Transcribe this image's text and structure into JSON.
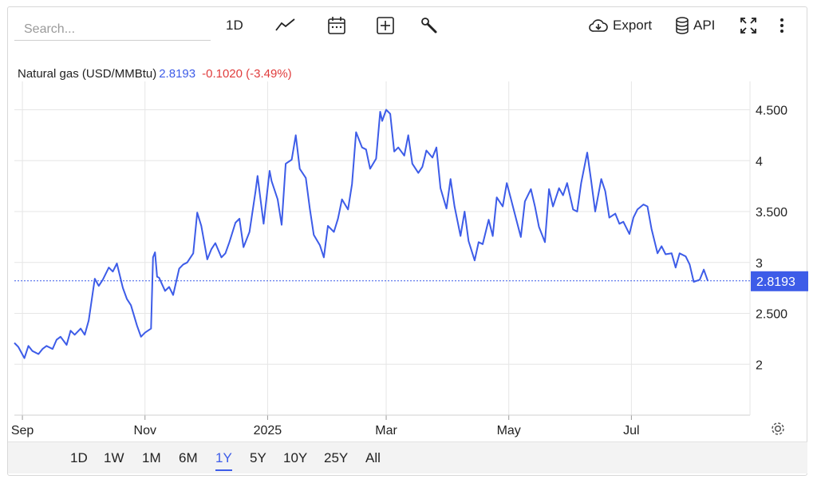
{
  "toolbar": {
    "search_placeholder": "Search...",
    "interval_label": "1D",
    "export_label": "Export",
    "api_label": "API",
    "icons": [
      "line-chart-icon",
      "calendar-icon",
      "add-indicator-icon",
      "wrench-icon",
      "cloud-download-icon",
      "database-icon",
      "fullscreen-icon",
      "more-vertical-icon"
    ]
  },
  "legend": {
    "name": "Natural gas (USD/MMBtu)",
    "price": "2.8193",
    "change": "-0.1020 (-3.49%)"
  },
  "colors": {
    "line": "#3d5ce8",
    "negative": "#e03c3c",
    "grid": "#e6e6e6"
  },
  "range_buttons": [
    "1D",
    "1W",
    "1M",
    "6M",
    "1Y",
    "5Y",
    "10Y",
    "25Y",
    "All"
  ],
  "active_range": "1Y",
  "chart_data": {
    "type": "line",
    "title": "Natural gas (USD/MMBtu)",
    "xlabel": "",
    "ylabel": "",
    "ylim": [
      1.5,
      4.7
    ],
    "y_ticks": [
      2,
      2.5,
      3,
      3.5,
      4,
      4.5
    ],
    "y_tick_labels": [
      "2",
      "2.500",
      "3",
      "3.500",
      "4",
      "4.500"
    ],
    "x_tick_labels": [
      "Sep",
      "Nov",
      "2025",
      "Mar",
      "May",
      "Jul"
    ],
    "x_tick_dates": [
      "2024-09-01",
      "2024-11-01",
      "2025-01-01",
      "2025-03-01",
      "2025-05-01",
      "2025-07-01"
    ],
    "x_range": [
      "2024-08-28",
      "2025-08-29"
    ],
    "last_value": 2.8193,
    "last_value_label": "2.8193",
    "grid": true,
    "series": [
      {
        "values": [
          [
            "2024-08-28",
            2.21
          ],
          [
            "2024-08-30",
            2.17
          ],
          [
            "2024-09-02",
            2.06
          ],
          [
            "2024-09-04",
            2.18
          ],
          [
            "2024-09-06",
            2.13
          ],
          [
            "2024-09-09",
            2.1
          ],
          [
            "2024-09-11",
            2.15
          ],
          [
            "2024-09-13",
            2.18
          ],
          [
            "2024-09-16",
            2.15
          ],
          [
            "2024-09-18",
            2.24
          ],
          [
            "2024-09-20",
            2.27
          ],
          [
            "2024-09-23",
            2.19
          ],
          [
            "2024-09-25",
            2.33
          ],
          [
            "2024-09-27",
            2.29
          ],
          [
            "2024-09-30",
            2.35
          ],
          [
            "2024-10-02",
            2.29
          ],
          [
            "2024-10-04",
            2.43
          ],
          [
            "2024-10-07",
            2.84
          ],
          [
            "2024-10-09",
            2.77
          ],
          [
            "2024-10-11",
            2.83
          ],
          [
            "2024-10-14",
            2.95
          ],
          [
            "2024-10-16",
            2.91
          ],
          [
            "2024-10-18",
            2.99
          ],
          [
            "2024-10-21",
            2.75
          ],
          [
            "2024-10-23",
            2.64
          ],
          [
            "2024-10-25",
            2.58
          ],
          [
            "2024-10-28",
            2.38
          ],
          [
            "2024-10-30",
            2.27
          ],
          [
            "2024-11-01",
            2.31
          ],
          [
            "2024-11-04",
            2.35
          ],
          [
            "2024-11-05",
            3.05
          ],
          [
            "2024-11-06",
            3.1
          ],
          [
            "2024-11-07",
            2.86
          ],
          [
            "2024-11-08",
            2.85
          ],
          [
            "2024-11-11",
            2.72
          ],
          [
            "2024-11-13",
            2.76
          ],
          [
            "2024-11-15",
            2.68
          ],
          [
            "2024-11-18",
            2.94
          ],
          [
            "2024-11-20",
            2.98
          ],
          [
            "2024-11-22",
            3.0
          ],
          [
            "2024-11-25",
            3.09
          ],
          [
            "2024-11-27",
            3.49
          ],
          [
            "2024-11-29",
            3.36
          ],
          [
            "2024-12-02",
            3.03
          ],
          [
            "2024-12-04",
            3.13
          ],
          [
            "2024-12-06",
            3.19
          ],
          [
            "2024-12-09",
            3.05
          ],
          [
            "2024-12-11",
            3.09
          ],
          [
            "2024-12-13",
            3.2
          ],
          [
            "2024-12-16",
            3.39
          ],
          [
            "2024-12-18",
            3.43
          ],
          [
            "2024-12-20",
            3.15
          ],
          [
            "2024-12-23",
            3.3
          ],
          [
            "2024-12-26",
            3.7
          ],
          [
            "2024-12-27",
            3.85
          ],
          [
            "2024-12-30",
            3.38
          ],
          [
            "2025-01-02",
            3.9
          ],
          [
            "2025-01-03",
            3.8
          ],
          [
            "2025-01-06",
            3.62
          ],
          [
            "2025-01-08",
            3.37
          ],
          [
            "2025-01-10",
            3.97
          ],
          [
            "2025-01-13",
            4.01
          ],
          [
            "2025-01-15",
            4.25
          ],
          [
            "2025-01-17",
            3.92
          ],
          [
            "2025-01-20",
            3.83
          ],
          [
            "2025-01-22",
            3.53
          ],
          [
            "2025-01-24",
            3.27
          ],
          [
            "2025-01-27",
            3.17
          ],
          [
            "2025-01-29",
            3.05
          ],
          [
            "2025-01-31",
            3.36
          ],
          [
            "2025-02-03",
            3.3
          ],
          [
            "2025-02-05",
            3.43
          ],
          [
            "2025-02-07",
            3.62
          ],
          [
            "2025-02-10",
            3.52
          ],
          [
            "2025-02-12",
            3.77
          ],
          [
            "2025-02-14",
            4.28
          ],
          [
            "2025-02-17",
            4.13
          ],
          [
            "2025-02-19",
            4.11
          ],
          [
            "2025-02-21",
            3.92
          ],
          [
            "2025-02-24",
            4.02
          ],
          [
            "2025-02-26",
            4.48
          ],
          [
            "2025-02-27",
            4.39
          ],
          [
            "2025-03-01",
            4.5
          ],
          [
            "2025-03-03",
            4.46
          ],
          [
            "2025-03-05",
            4.09
          ],
          [
            "2025-03-07",
            4.13
          ],
          [
            "2025-03-10",
            4.05
          ],
          [
            "2025-03-12",
            4.25
          ],
          [
            "2025-03-14",
            3.97
          ],
          [
            "2025-03-17",
            3.88
          ],
          [
            "2025-03-19",
            3.94
          ],
          [
            "2025-03-21",
            4.1
          ],
          [
            "2025-03-24",
            4.03
          ],
          [
            "2025-03-26",
            4.13
          ],
          [
            "2025-03-28",
            3.73
          ],
          [
            "2025-03-31",
            3.53
          ],
          [
            "2025-04-02",
            3.82
          ],
          [
            "2025-04-04",
            3.55
          ],
          [
            "2025-04-07",
            3.26
          ],
          [
            "2025-04-09",
            3.5
          ],
          [
            "2025-04-11",
            3.21
          ],
          [
            "2025-04-14",
            3.02
          ],
          [
            "2025-04-16",
            3.2
          ],
          [
            "2025-04-18",
            3.18
          ],
          [
            "2025-04-21",
            3.42
          ],
          [
            "2025-04-23",
            3.26
          ],
          [
            "2025-04-25",
            3.64
          ],
          [
            "2025-04-28",
            3.55
          ],
          [
            "2025-04-30",
            3.78
          ],
          [
            "2025-05-02",
            3.63
          ],
          [
            "2025-05-05",
            3.4
          ],
          [
            "2025-05-07",
            3.25
          ],
          [
            "2025-05-09",
            3.6
          ],
          [
            "2025-05-12",
            3.72
          ],
          [
            "2025-05-14",
            3.55
          ],
          [
            "2025-05-16",
            3.35
          ],
          [
            "2025-05-19",
            3.2
          ],
          [
            "2025-05-21",
            3.72
          ],
          [
            "2025-05-23",
            3.55
          ],
          [
            "2025-05-26",
            3.73
          ],
          [
            "2025-05-28",
            3.66
          ],
          [
            "2025-05-30",
            3.78
          ],
          [
            "2025-06-02",
            3.52
          ],
          [
            "2025-06-04",
            3.5
          ],
          [
            "2025-06-06",
            3.78
          ],
          [
            "2025-06-09",
            4.08
          ],
          [
            "2025-06-11",
            3.8
          ],
          [
            "2025-06-13",
            3.5
          ],
          [
            "2025-06-16",
            3.82
          ],
          [
            "2025-06-18",
            3.7
          ],
          [
            "2025-06-20",
            3.44
          ],
          [
            "2025-06-23",
            3.48
          ],
          [
            "2025-06-25",
            3.38
          ],
          [
            "2025-06-27",
            3.4
          ],
          [
            "2025-06-30",
            3.28
          ],
          [
            "2025-07-02",
            3.44
          ],
          [
            "2025-07-04",
            3.52
          ],
          [
            "2025-07-07",
            3.57
          ],
          [
            "2025-07-09",
            3.55
          ],
          [
            "2025-07-11",
            3.33
          ],
          [
            "2025-07-14",
            3.09
          ],
          [
            "2025-07-16",
            3.16
          ],
          [
            "2025-07-18",
            3.08
          ],
          [
            "2025-07-21",
            3.09
          ],
          [
            "2025-07-23",
            2.95
          ],
          [
            "2025-07-25",
            3.09
          ],
          [
            "2025-07-28",
            3.06
          ],
          [
            "2025-07-30",
            2.98
          ],
          [
            "2025-08-01",
            2.81
          ],
          [
            "2025-08-04",
            2.83
          ],
          [
            "2025-08-06",
            2.93
          ],
          [
            "2025-08-08",
            2.8193
          ]
        ]
      }
    ]
  }
}
